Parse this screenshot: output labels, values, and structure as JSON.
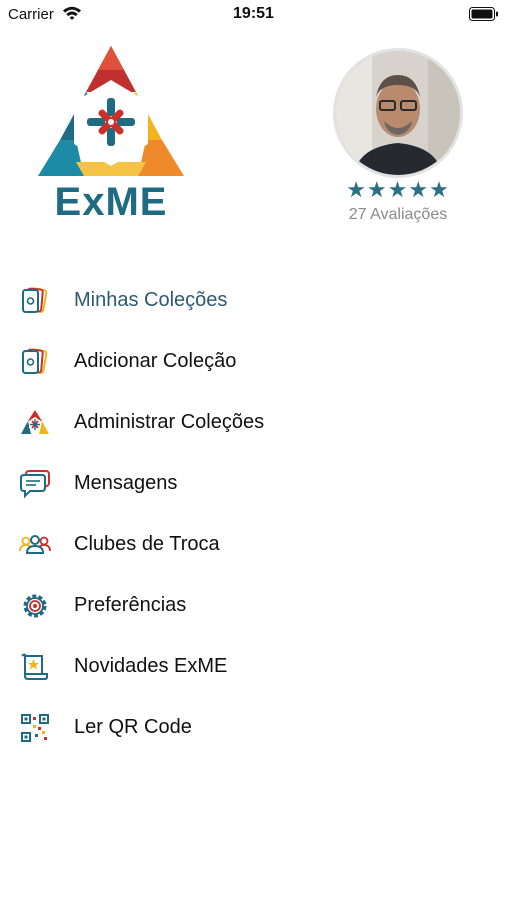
{
  "status_bar": {
    "carrier": "Carrier",
    "time": "19:51"
  },
  "brand": {
    "name": "ExME"
  },
  "profile": {
    "stars": "★★★★★",
    "rating_count": "27 Avaliações"
  },
  "menu": {
    "items": [
      {
        "label": "Minhas Coleções",
        "icon": "cards-icon",
        "active": true
      },
      {
        "label": "Adicionar Coleção",
        "icon": "cards-add-icon"
      },
      {
        "label": "Administrar Coleções",
        "icon": "triangle-logo-icon"
      },
      {
        "label": "Mensagens",
        "icon": "chat-bubbles-icon"
      },
      {
        "label": "Clubes de Troca",
        "icon": "group-icon"
      },
      {
        "label": "Preferências",
        "icon": "gear-icon"
      },
      {
        "label": "Novidades ExME",
        "icon": "scroll-icon"
      },
      {
        "label": "Ler QR Code",
        "icon": "qr-code-icon"
      }
    ]
  },
  "colors": {
    "teal": "#1f6b84",
    "navy": "#2d5a70",
    "red": "#c9302c",
    "yellow": "#f2b41c",
    "orange": "#ef8a2c"
  }
}
